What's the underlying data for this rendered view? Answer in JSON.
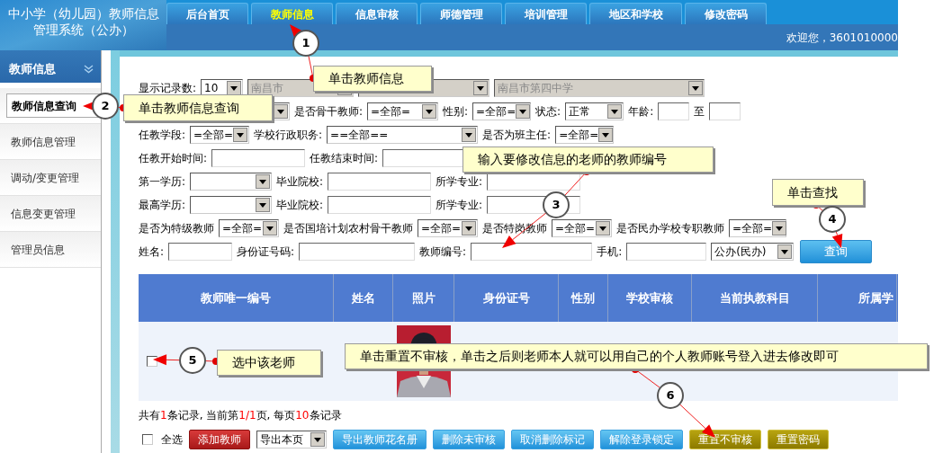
{
  "header": {
    "title_lines": [
      "中小学（幼儿园）教师信息",
      "管理系统（公办）"
    ],
    "welcome": "欢迎您，3601010000"
  },
  "tabs": [
    {
      "label": "后台首页",
      "selected": false
    },
    {
      "label": "教师信息",
      "selected": true
    },
    {
      "label": "信息审核",
      "selected": false
    },
    {
      "label": "师德管理",
      "selected": false
    },
    {
      "label": "培训管理",
      "selected": false
    },
    {
      "label": "地区和学校",
      "selected": false
    },
    {
      "label": "修改密码",
      "selected": false
    }
  ],
  "sidebar": {
    "title": "教师信息",
    "items": [
      {
        "label": "教师信息查询",
        "selected": true
      },
      {
        "label": "教师信息管理",
        "selected": false
      },
      {
        "label": "调动/变更管理",
        "selected": false
      },
      {
        "label": "信息变更管理",
        "selected": false
      },
      {
        "label": "管理员信息",
        "selected": false
      }
    ]
  },
  "filters": [
    [
      {
        "kind": "label",
        "text": "显示记录数:"
      },
      {
        "kind": "select",
        "value": "10",
        "disabled": false
      },
      {
        "kind": "select",
        "value": "南昌市",
        "disabled": true
      },
      {
        "kind": "select",
        "disabled": true
      },
      {
        "kind": "select",
        "value": "南昌市第四中学",
        "disabled": true
      }
    ],
    [
      {
        "kind": "select",
        "disabled": false
      },
      {
        "kind": "label",
        "text": "是否骨干教师:"
      },
      {
        "kind": "select",
        "value": "=全部=",
        "disabled": false
      },
      {
        "kind": "label",
        "text": "性别:"
      },
      {
        "kind": "select",
        "value": "=全部=",
        "disabled": false
      },
      {
        "kind": "label",
        "text": "状态:"
      },
      {
        "kind": "select",
        "value": "正常",
        "disabled": false
      },
      {
        "kind": "label",
        "text": "年龄:"
      },
      {
        "kind": "input"
      },
      {
        "kind": "label",
        "text": "至"
      },
      {
        "kind": "input"
      }
    ],
    [
      {
        "kind": "label",
        "text": "任教学段:"
      },
      {
        "kind": "select",
        "value": "=全部=",
        "disabled": false
      },
      {
        "kind": "label",
        "text": "学校行政职务:"
      },
      {
        "kind": "select",
        "value": "==全部==",
        "disabled": false
      },
      {
        "kind": "label",
        "text": "是否为班主任:"
      },
      {
        "kind": "select",
        "value": "=全部=",
        "disabled": false
      }
    ],
    [
      {
        "kind": "label",
        "text": "任教开始时间:"
      },
      {
        "kind": "input"
      },
      {
        "kind": "label",
        "text": "任教结束时间:"
      },
      {
        "kind": "input"
      }
    ],
    [
      {
        "kind": "label",
        "text": "第一学历:"
      },
      {
        "kind": "select",
        "disabled": false
      },
      {
        "kind": "label",
        "text": "毕业院校:"
      },
      {
        "kind": "input"
      },
      {
        "kind": "label",
        "text": "所学专业:"
      },
      {
        "kind": "input"
      }
    ],
    [
      {
        "kind": "label",
        "text": "最高学历:"
      },
      {
        "kind": "select",
        "disabled": false
      },
      {
        "kind": "label",
        "text": "毕业院校:"
      },
      {
        "kind": "input"
      },
      {
        "kind": "label",
        "text": "所学专业:"
      },
      {
        "kind": "input"
      }
    ],
    [
      {
        "kind": "label",
        "text": "是否为特级教师"
      },
      {
        "kind": "select",
        "value": "=全部=",
        "disabled": false
      },
      {
        "kind": "label",
        "text": "是否国培计划农村骨干教师"
      },
      {
        "kind": "select",
        "value": "=全部=",
        "disabled": false
      },
      {
        "kind": "label",
        "text": "是否特岗教师"
      },
      {
        "kind": "select",
        "value": "=全部=",
        "disabled": false
      },
      {
        "kind": "label",
        "text": "是否民办学校专职教师"
      },
      {
        "kind": "select",
        "value": "=全部=",
        "disabled": false
      }
    ],
    [
      {
        "kind": "label",
        "text": "姓名:"
      },
      {
        "kind": "input"
      },
      {
        "kind": "label",
        "text": "身份证号码:"
      },
      {
        "kind": "input"
      },
      {
        "kind": "label",
        "text": "教师编号:"
      },
      {
        "kind": "input"
      },
      {
        "kind": "label",
        "text": "手机:"
      },
      {
        "kind": "input"
      },
      {
        "kind": "select",
        "value": "公办(民办)",
        "disabled": false
      },
      {
        "kind": "button",
        "label": "查询"
      }
    ]
  ],
  "table": {
    "columns": [
      "教师唯一编号",
      "姓名",
      "照片",
      "身份证号",
      "性别",
      "学校审核",
      "当前执教科目",
      "所属学"
    ],
    "rows": [
      {
        "checked": false
      }
    ]
  },
  "summary": [
    {
      "text": "共有",
      "highlight": false
    },
    {
      "text": "1",
      "highlight": true
    },
    {
      "text": "条记录, 当前第",
      "highlight": false
    },
    {
      "text": "1/1",
      "highlight": true
    },
    {
      "text": "页, 每页",
      "highlight": false
    },
    {
      "text": "10",
      "highlight": true
    },
    {
      "text": "条记录",
      "highlight": false
    }
  ],
  "actions": [
    {
      "kind": "checkbox",
      "label": "全选",
      "checked": false
    },
    {
      "kind": "danger_button",
      "label": "添加教师"
    },
    {
      "kind": "select",
      "value": "导出本页"
    },
    {
      "kind": "primary_button",
      "label": "导出教师花名册"
    },
    {
      "kind": "primary_button",
      "label": "删除未审核"
    },
    {
      "kind": "primary_button",
      "label": "取消删除标记"
    },
    {
      "kind": "primary_button",
      "label": "解除登录锁定"
    },
    {
      "kind": "accent_button",
      "label": "重置不审核"
    },
    {
      "kind": "accent_button",
      "label": "重置密码"
    }
  ],
  "annotations": [
    {
      "number": "1",
      "text": "单击教师信息"
    },
    {
      "number": "2",
      "text": "单击教师信息查询"
    },
    {
      "number": "3",
      "text": "输入要修改信息的老师的教师编号"
    },
    {
      "number": "4",
      "text": "单击查找"
    },
    {
      "number": "5",
      "text": "选中该老师"
    },
    {
      "number": "6",
      "text": "单击重置不审核，单击之后则老师本人就可以用自己的个人教师账号登入进去修改即可"
    }
  ]
}
